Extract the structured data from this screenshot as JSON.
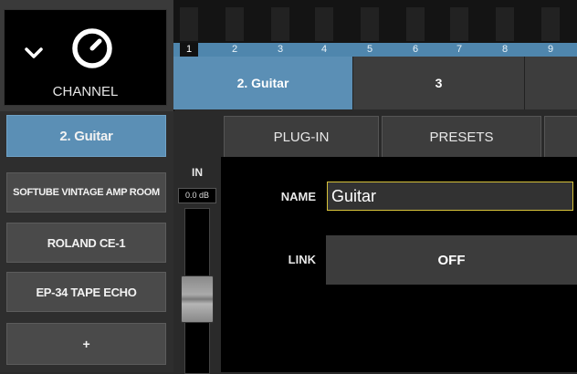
{
  "channel": {
    "label": "CHANNEL",
    "icons": {
      "collapse": "chevron-down-icon",
      "knob": "knob-icon"
    }
  },
  "channel_strip": {
    "numbers": [
      "1",
      "2",
      "3",
      "4",
      "5",
      "6",
      "7",
      "8",
      "9"
    ]
  },
  "track_tabs": [
    {
      "label": "2. Guitar",
      "active": true
    },
    {
      "label": "3",
      "active": false
    },
    {
      "label": "",
      "active": false
    }
  ],
  "sidebar": {
    "track_name": "2. Guitar",
    "slots": [
      "SOFTUBE VINTAGE AMP ROOM",
      "ROLAND CE-1",
      "EP-34 TAPE ECHO"
    ],
    "add_label": "+"
  },
  "input": {
    "label": "IN",
    "value": "0.0 dB"
  },
  "plugin_tabs": {
    "plugin": "PLUG-IN",
    "presets": "PRESETS"
  },
  "form": {
    "name_label": "NAME",
    "name_value": "Guitar",
    "link_label": "LINK",
    "link_value": "OFF"
  },
  "colors": {
    "accent": "#5b8fb5",
    "field_border": "#d7c23a",
    "panel": "#000000"
  }
}
